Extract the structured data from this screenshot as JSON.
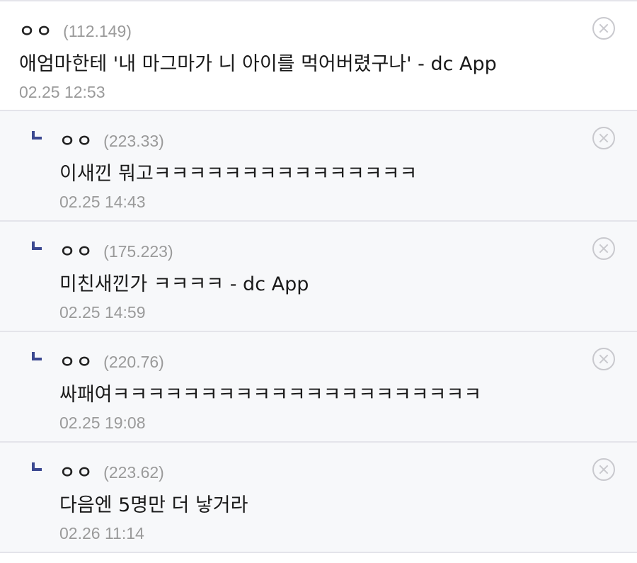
{
  "comments": [
    {
      "nick": "ㅇㅇ",
      "ip": "(112.149)",
      "text": "애엄마한테 '내 마그마가 니 아이를 먹어버렸구나' - dc App",
      "date": "02.25 12:53"
    },
    {
      "nick": "ㅇㅇ",
      "ip": "(223.33)",
      "text": "이새낀 뭐고ㅋㅋㅋㅋㅋㅋㅋㅋㅋㅋㅋㅋㅋㅋㅋ",
      "date": "02.25 14:43"
    },
    {
      "nick": "ㅇㅇ",
      "ip": "(175.223)",
      "text": "미친새낀가 ㅋㅋㅋㅋ - dc App",
      "date": "02.25 14:59"
    },
    {
      "nick": "ㅇㅇ",
      "ip": "(220.76)",
      "text": "싸패여ㅋㅋㅋㅋㅋㅋㅋㅋㅋㅋㅋㅋㅋㅋㅋㅋㅋㅋㅋㅋㅋ",
      "date": "02.25 19:08"
    },
    {
      "nick": "ㅇㅇ",
      "ip": "(223.62)",
      "text": "다음엔 5명만 더 낳거라",
      "date": "02.26 11:14"
    }
  ],
  "icons": {
    "delete": "close-circle-icon",
    "reply": "reply-arrow-icon"
  },
  "colors": {
    "reply_marker": "#3b4890",
    "reply_background": "#f7f8fa",
    "meta_text": "#9a9a9a"
  }
}
